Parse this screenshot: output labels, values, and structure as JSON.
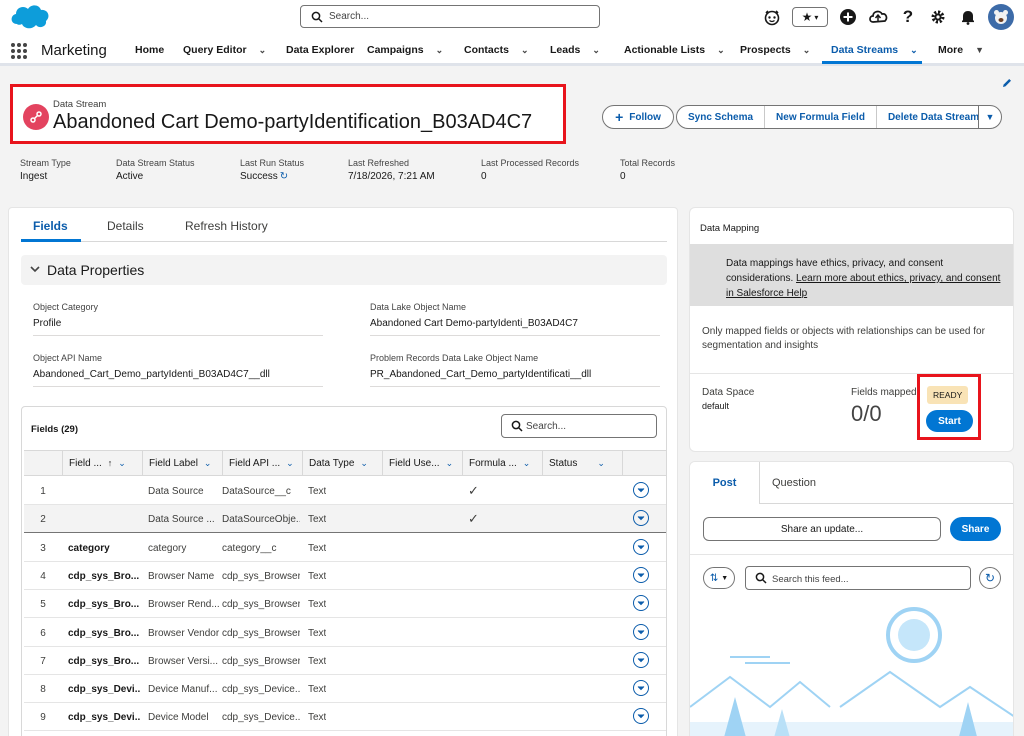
{
  "global": {
    "search_placeholder": "Search..."
  },
  "nav": {
    "app_name": "Marketing",
    "items": [
      {
        "label": "Home"
      },
      {
        "label": "Query Editor"
      },
      {
        "label": "Data Explorer"
      },
      {
        "label": "Campaigns"
      },
      {
        "label": "Contacts"
      },
      {
        "label": "Leads"
      },
      {
        "label": "Actionable Lists"
      },
      {
        "label": "Prospects"
      },
      {
        "label": "Data Streams"
      },
      {
        "label": "More"
      }
    ],
    "active": "Data Streams"
  },
  "record": {
    "object_type": "Data Stream",
    "title": "Abandoned Cart Demo-partyIdentification_B03AD4C7",
    "buttons": {
      "follow": "Follow",
      "sync_schema": "Sync Schema",
      "new_formula_field": "New Formula Field",
      "delete": "Delete Data Stream"
    },
    "highlights": [
      {
        "label": "Stream Type",
        "value": "Ingest"
      },
      {
        "label": "Data Stream Status",
        "value": "Active"
      },
      {
        "label": "Last Run Status",
        "value": "Success"
      },
      {
        "label": "Last Refreshed",
        "value": "7/18/2026, 7:21 AM"
      },
      {
        "label": "Last Processed Records",
        "value": "0"
      },
      {
        "label": "Total Records",
        "value": "0"
      }
    ]
  },
  "tabs": [
    "Fields",
    "Details",
    "Refresh History"
  ],
  "data_properties": {
    "title": "Data Properties",
    "fields": [
      {
        "label": "Object Category",
        "value": "Profile"
      },
      {
        "label": "Data Lake Object Name",
        "value": "Abandoned Cart Demo-partyIdenti_B03AD4C7"
      },
      {
        "label": "Object API Name",
        "value": "Abandoned_Cart_Demo_partyIdenti_B03AD4C7__dll"
      },
      {
        "label": "Problem Records Data Lake Object Name",
        "value": "PR_Abandoned_Cart_Demo_partyIdentificati__dll"
      }
    ]
  },
  "fields_table": {
    "title": "Fields (29)",
    "search_placeholder": "Search...",
    "columns": [
      "Field ...",
      "Field Label",
      "Field API ...",
      "Data Type",
      "Field Use...",
      "Formula ...",
      "Status"
    ],
    "rows": [
      {
        "n": "1",
        "name": "",
        "label": "Data Source",
        "api": "DataSource__c",
        "type": "Text",
        "formula": true
      },
      {
        "n": "2",
        "name": "",
        "label": "Data Source ...",
        "api": "DataSourceObje...",
        "type": "Text",
        "formula": true
      },
      {
        "n": "3",
        "name": "category",
        "label": "category",
        "api": "category__c",
        "type": "Text",
        "formula": false
      },
      {
        "n": "4",
        "name": "cdp_sys_Bro...",
        "label": "Browser Name",
        "api": "cdp_sys_Browser...",
        "type": "Text",
        "formula": false
      },
      {
        "n": "5",
        "name": "cdp_sys_Bro...",
        "label": "Browser Rend...",
        "api": "cdp_sys_Browser...",
        "type": "Text",
        "formula": false
      },
      {
        "n": "6",
        "name": "cdp_sys_Bro...",
        "label": "Browser Vendor",
        "api": "cdp_sys_Browser...",
        "type": "Text",
        "formula": false
      },
      {
        "n": "7",
        "name": "cdp_sys_Bro...",
        "label": "Browser Versi...",
        "api": "cdp_sys_Browser...",
        "type": "Text",
        "formula": false
      },
      {
        "n": "8",
        "name": "cdp_sys_Devi...",
        "label": "Device Manuf...",
        "api": "cdp_sys_Device...",
        "type": "Text",
        "formula": false
      },
      {
        "n": "9",
        "name": "cdp_sys_Devi...",
        "label": "Device Model",
        "api": "cdp_sys_Device...",
        "type": "Text",
        "formula": false
      }
    ]
  },
  "mapping": {
    "title": "Data Mapping",
    "info_text": "Data mappings have ethics, privacy, and consent considerations.",
    "info_link": "Learn more about ethics, privacy, and consent in Salesforce Help",
    "note": "Only mapped fields or objects with relationships can be used for segmentation and insights",
    "data_space_label": "Data Space",
    "data_space_value": "default",
    "fields_mapped_label": "Fields mapped",
    "fields_mapped_value": "0/0",
    "status": "READY",
    "start": "Start"
  },
  "feed": {
    "tab_post": "Post",
    "tab_question": "Question",
    "share_placeholder": "Share an update...",
    "share_button": "Share",
    "search_placeholder": "Search this feed..."
  },
  "colors": {
    "brand": "#0176d3",
    "highlight_box": "#e8141c",
    "object_icon": "#e3435f"
  }
}
